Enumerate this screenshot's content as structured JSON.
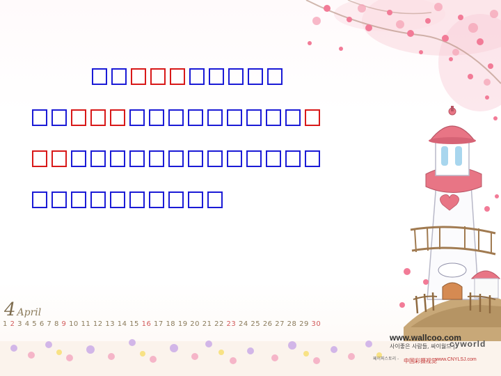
{
  "slide": {
    "text_lines": [
      {
        "glyphs": [
          "b",
          "b",
          "r",
          "r",
          "r",
          "b",
          "b",
          "b",
          "b",
          "b"
        ]
      },
      {
        "glyphs": [
          "b",
          "b",
          "r",
          "r",
          "r",
          "b",
          "b",
          "b",
          "b",
          "b",
          "b",
          "b",
          "b",
          "b",
          "r"
        ]
      },
      {
        "glyphs": [
          "r",
          "r",
          "b",
          "b",
          "b",
          "b",
          "b",
          "b",
          "b",
          "b",
          "b",
          "b",
          "b",
          "b",
          "b"
        ]
      },
      {
        "glyphs": [
          "b",
          "b",
          "b",
          "b",
          "b",
          "b",
          "b",
          "b",
          "b",
          "b"
        ]
      }
    ],
    "colors": {
      "blue_text": "#1a1ad6",
      "red_text": "#d81818"
    }
  },
  "calendar": {
    "month_number": "4",
    "month_name": "April",
    "days": [
      "1",
      "2",
      "3",
      "4",
      "5",
      "6",
      "7",
      "8",
      "9",
      "10",
      "11",
      "12",
      "13",
      "14",
      "15",
      "16",
      "17",
      "18",
      "19",
      "20",
      "21",
      "22",
      "23",
      "24",
      "25",
      "26",
      "27",
      "28",
      "29",
      "30"
    ],
    "highlighted_days": [
      "2",
      "9",
      "16",
      "23",
      "30"
    ]
  },
  "watermark": {
    "site": "www.wallcoo.com",
    "korean_line": "사이좋은 사람들, 싸이월드 |",
    "brand": "cyworld",
    "korean_small": "페이퍼스토리 -",
    "chinese": "中国彩摄视觉",
    "url2": "www.CNYLSJ.com"
  }
}
